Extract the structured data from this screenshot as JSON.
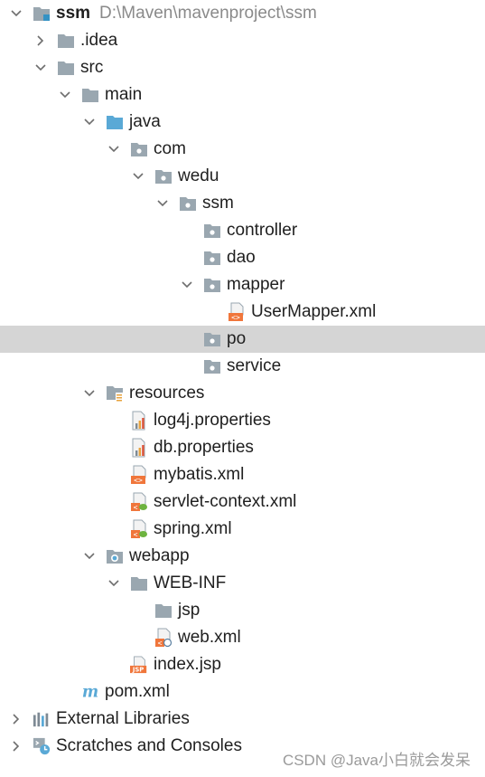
{
  "project": {
    "name": "ssm",
    "path": "D:\\Maven\\mavenproject\\ssm"
  },
  "tree": [
    {
      "label": "ssm",
      "icon": "module-folder-icon",
      "arrow": "expanded",
      "indent": 0
    },
    {
      "label": ".idea",
      "icon": "folder-icon",
      "arrow": "collapsed",
      "indent": 1
    },
    {
      "label": "src",
      "icon": "folder-icon",
      "arrow": "expanded",
      "indent": 1
    },
    {
      "label": "main",
      "icon": "folder-icon",
      "arrow": "expanded",
      "indent": 2
    },
    {
      "label": "java",
      "icon": "source-folder-icon",
      "arrow": "expanded",
      "indent": 3
    },
    {
      "label": "com",
      "icon": "package-icon",
      "arrow": "expanded",
      "indent": 4
    },
    {
      "label": "wedu",
      "icon": "package-icon",
      "arrow": "expanded",
      "indent": 5
    },
    {
      "label": "ssm",
      "icon": "package-icon",
      "arrow": "expanded",
      "indent": 6
    },
    {
      "label": "controller",
      "icon": "package-icon",
      "arrow": "none",
      "indent": 7
    },
    {
      "label": "dao",
      "icon": "package-icon",
      "arrow": "none",
      "indent": 7
    },
    {
      "label": "mapper",
      "icon": "package-icon",
      "arrow": "expanded",
      "indent": 7
    },
    {
      "label": "UserMapper.xml",
      "icon": "xml-file-icon",
      "arrow": "none",
      "indent": 8
    },
    {
      "label": "po",
      "icon": "package-icon",
      "arrow": "none",
      "indent": 7,
      "selected": true
    },
    {
      "label": "service",
      "icon": "package-icon",
      "arrow": "none",
      "indent": 7
    },
    {
      "label": "resources",
      "icon": "resources-folder-icon",
      "arrow": "expanded",
      "indent": 3
    },
    {
      "label": "log4j.properties",
      "icon": "properties-file-icon",
      "arrow": "none",
      "indent": 4
    },
    {
      "label": "db.properties",
      "icon": "properties-file-icon",
      "arrow": "none",
      "indent": 4
    },
    {
      "label": "mybatis.xml",
      "icon": "xml-file-icon",
      "arrow": "none",
      "indent": 4
    },
    {
      "label": "servlet-context.xml",
      "icon": "spring-xml-file-icon",
      "arrow": "none",
      "indent": 4
    },
    {
      "label": "spring.xml",
      "icon": "spring-xml-file-icon",
      "arrow": "none",
      "indent": 4
    },
    {
      "label": "webapp",
      "icon": "web-folder-icon",
      "arrow": "expanded",
      "indent": 3
    },
    {
      "label": "WEB-INF",
      "icon": "folder-icon",
      "arrow": "expanded",
      "indent": 4
    },
    {
      "label": "jsp",
      "icon": "folder-icon",
      "arrow": "none",
      "indent": 5
    },
    {
      "label": "web.xml",
      "icon": "web-xml-file-icon",
      "arrow": "none",
      "indent": 5
    },
    {
      "label": "index.jsp",
      "icon": "jsp-file-icon",
      "arrow": "none",
      "indent": 4
    },
    {
      "label": "pom.xml",
      "icon": "maven-file-icon",
      "arrow": "none",
      "indent": 2
    },
    {
      "label": "External Libraries",
      "icon": "libraries-icon",
      "arrow": "collapsed",
      "indent": 0
    },
    {
      "label": "Scratches and Consoles",
      "icon": "scratches-icon",
      "arrow": "collapsed",
      "indent": 0
    }
  ],
  "watermark": "CSDN @Java小白就会发呆",
  "colors": {
    "selection": "#d5d5d5",
    "folder": "#9aa7b0",
    "source_folder": "#5aa9d6",
    "xml": "#f0763b",
    "spring": "#6db33f",
    "properties_bar": "#e8a33d"
  }
}
